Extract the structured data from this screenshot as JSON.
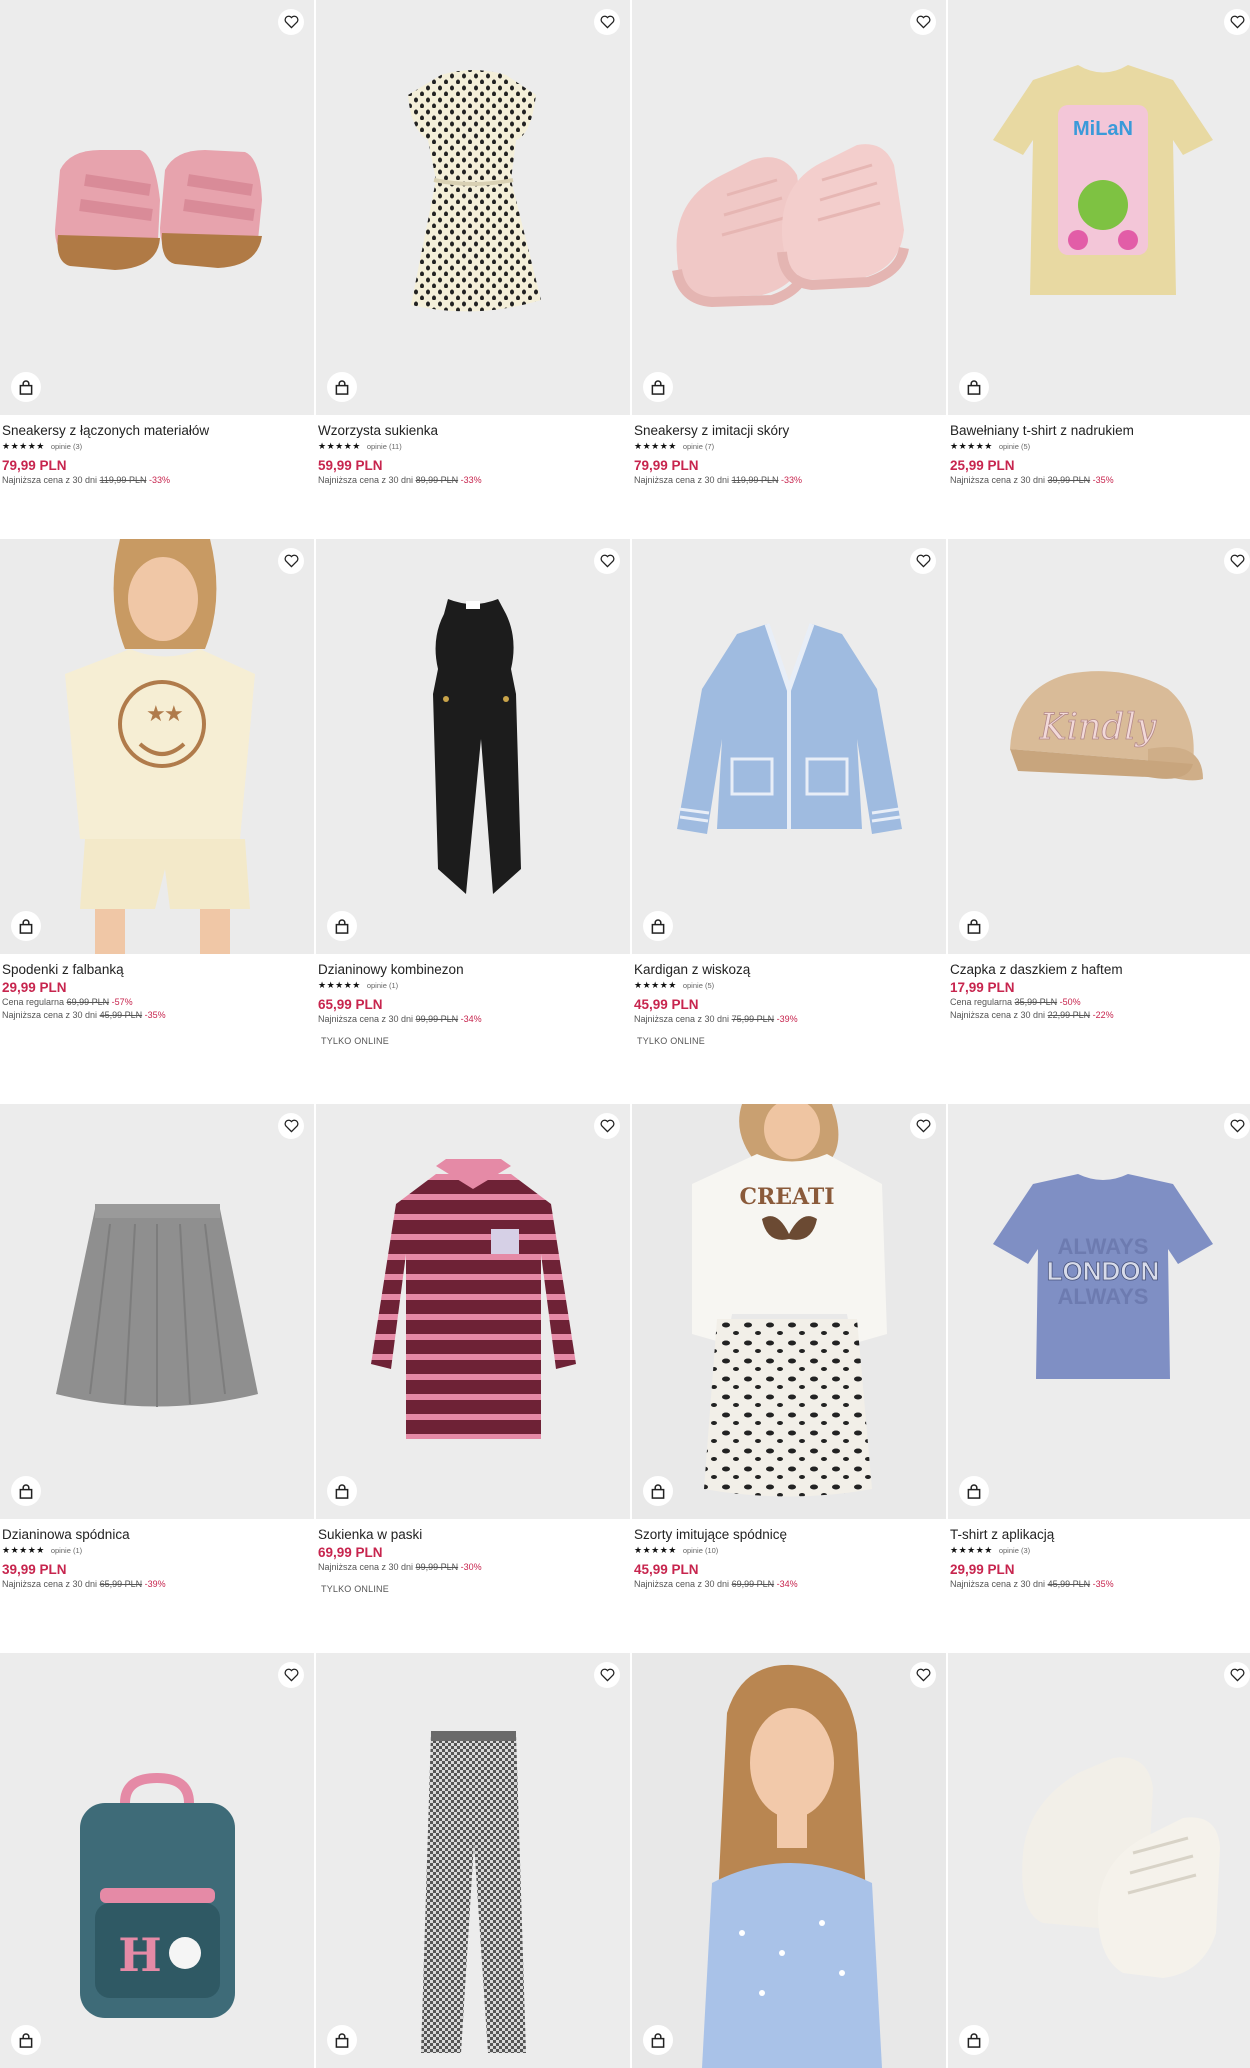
{
  "icons": {
    "wishlist": "heart-icon",
    "cart": "shopping-bag-icon"
  },
  "colors": {
    "price": "#c7254e",
    "discount": "#c7254e",
    "image_bg": "#ececec"
  },
  "products": [
    {
      "title": "Sneakersy z łączonych materiałów",
      "stars": "★★★★★",
      "opinions": "opinie (3)",
      "price": "79,99 PLN",
      "lowest_label": "Najniższa cena z 30 dni",
      "lowest_price": "119,99 PLN",
      "lowest_disc": "-33%"
    },
    {
      "title": "Wzorzysta sukienka",
      "stars": "★★★★★",
      "opinions": "opinie (11)",
      "price": "59,99 PLN",
      "lowest_label": "Najniższa cena z 30 dni",
      "lowest_price": "89,99 PLN",
      "lowest_disc": "-33%"
    },
    {
      "title": "Sneakersy z imitacji skóry",
      "stars": "★★★★★",
      "opinions": "opinie (7)",
      "price": "79,99 PLN",
      "lowest_label": "Najniższa cena z 30 dni",
      "lowest_price": "119,99 PLN",
      "lowest_disc": "-33%"
    },
    {
      "title": "Bawełniany t-shirt z nadrukiem",
      "stars": "★★★★★",
      "opinions": "opinie (5)",
      "price": "25,99 PLN",
      "lowest_label": "Najniższa cena z 30 dni",
      "lowest_price": "39,99 PLN",
      "lowest_disc": "-35%"
    },
    {
      "title": "Spodenki z falbanką",
      "price": "29,99 PLN",
      "regular_label": "Cena regularna",
      "regular_price": "69,99 PLN",
      "regular_disc": "-57%",
      "lowest_label": "Najniższa cena z 30 dni",
      "lowest_price": "45,99 PLN",
      "lowest_disc": "-35%"
    },
    {
      "title": "Dzianinowy kombinezon",
      "stars": "★★★★★",
      "opinions": "opinie (1)",
      "price": "65,99 PLN",
      "lowest_label": "Najniższa cena z 30 dni",
      "lowest_price": "99,99 PLN",
      "lowest_disc": "-34%",
      "online": "TYLKO ONLINE"
    },
    {
      "title": "Kardigan z wiskozą",
      "stars": "★★★★★",
      "opinions": "opinie (5)",
      "price": "45,99 PLN",
      "lowest_label": "Najniższa cena z 30 dni",
      "lowest_price": "75,99 PLN",
      "lowest_disc": "-39%",
      "online": "TYLKO ONLINE"
    },
    {
      "title": "Czapka z daszkiem z haftem",
      "price": "17,99 PLN",
      "regular_label": "Cena regularna",
      "regular_price": "35,99 PLN",
      "regular_disc": "-50%",
      "lowest_label": "Najniższa cena z 30 dni",
      "lowest_price": "22,99 PLN",
      "lowest_disc": "-22%"
    },
    {
      "title": "Dzianinowa spódnica",
      "stars": "★★★★★",
      "opinions": "opinie (1)",
      "price": "39,99 PLN",
      "lowest_label": "Najniższa cena z 30 dni",
      "lowest_price": "65,99 PLN",
      "lowest_disc": "-39%"
    },
    {
      "title": "Sukienka w paski",
      "price": "69,99 PLN",
      "lowest_label": "Najniższa cena z 30 dni",
      "lowest_price": "99,99 PLN",
      "lowest_disc": "-30%",
      "online": "TYLKO ONLINE"
    },
    {
      "title": "Szorty imitujące spódnicę",
      "stars": "★★★★★",
      "opinions": "opinie (10)",
      "price": "45,99 PLN",
      "lowest_label": "Najniższa cena z 30 dni",
      "lowest_price": "69,99 PLN",
      "lowest_disc": "-34%"
    },
    {
      "title": "T-shirt z aplikacją",
      "stars": "★★★★★",
      "opinions": "opinie (3)",
      "price": "29,99 PLN",
      "lowest_label": "Najniższa cena z 30 dni",
      "lowest_price": "45,99 PLN",
      "lowest_disc": "-35%"
    },
    {
      "art_text": "H"
    },
    {},
    {},
    {}
  ],
  "art": {
    "tshirt_logo": "MiLaN",
    "cap_text": "Kindly",
    "sweat_text": "CREATI",
    "london_top": "ALWAYS",
    "london_mid": "LONDON",
    "london_bot": "ALWAYS"
  }
}
